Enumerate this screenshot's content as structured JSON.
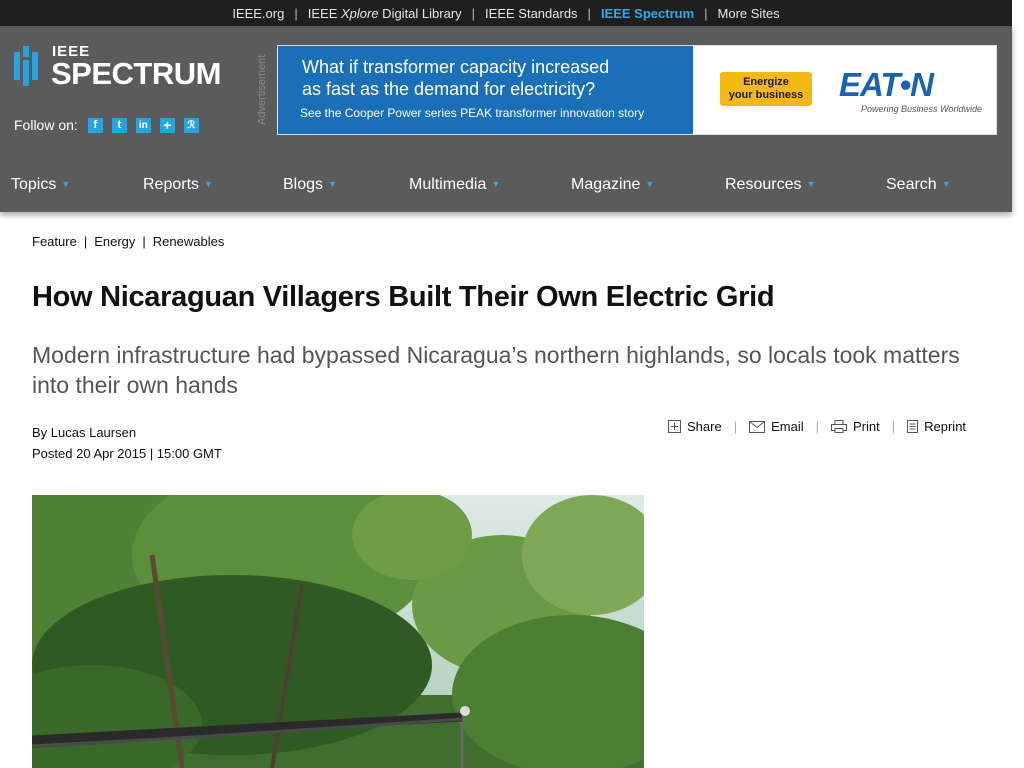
{
  "top_links": {
    "ieee_org": "IEEE.org",
    "xplore_prefix": "IEEE ",
    "xplore_em": "Xplore",
    "xplore_suffix": " Digital Library",
    "standards": "IEEE Standards",
    "spectrum": "IEEE Spectrum",
    "more_sites": "More Sites"
  },
  "logo": {
    "top": "IEEE",
    "main": "SPECTRUM"
  },
  "follow": {
    "label": "Follow on:",
    "icons": [
      "facebook-icon",
      "twitter-icon",
      "linkedin-icon",
      "googleplus-icon",
      "rss-icon"
    ]
  },
  "ad": {
    "label": "Advertisement",
    "headline_1": "What if transformer capacity increased",
    "headline_2": "as fast as the demand for electricity?",
    "subline": "See the Cooper Power series PEAK transformer innovation story",
    "button_1": "Energize",
    "button_2": "your business",
    "brand": "EAT•N",
    "tagline": "Powering Business Worldwide"
  },
  "nav": [
    "Topics",
    "Reports",
    "Blogs",
    "Multimedia",
    "Magazine",
    "Resources",
    "Search"
  ],
  "breadcrumb": [
    "Feature",
    "Energy",
    "Renewables"
  ],
  "article": {
    "title": "How Nicaraguan Villagers Built Their Own Electric Grid",
    "dek": "Modern infrastructure had bypassed Nicaragua’s northern highlands, so locals took matters into their own hands",
    "author": "By Lucas Laursen",
    "posted": "Posted 20 Apr 2015 | 15:00 GMT"
  },
  "tools": {
    "share": "Share",
    "email": "Email",
    "print": "Print",
    "reprint": "Reprint"
  },
  "colors": {
    "accent": "#35a9e6",
    "header_bg": "#5b5b5b",
    "topbar_bg": "#1f1f1f",
    "ad_blue": "#1b6fb8",
    "ad_button": "#f5b915"
  }
}
